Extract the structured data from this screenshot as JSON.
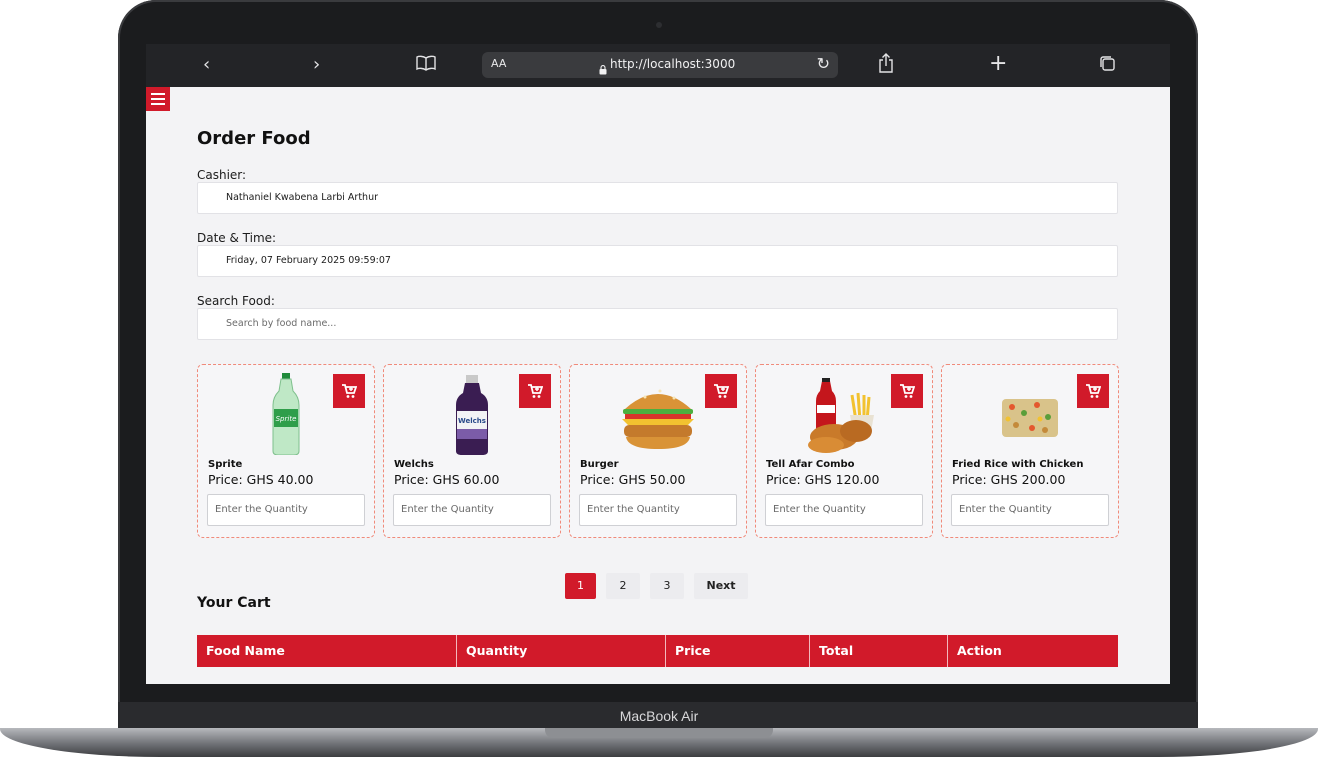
{
  "browser": {
    "aa_label": "AA",
    "url": "http://localhost:3000"
  },
  "device": {
    "label": "MacBook Air"
  },
  "page": {
    "title": "Order Food",
    "cashier_label": "Cashier:",
    "cashier_value": "Nathaniel Kwabena Larbi Arthur",
    "datetime_label": "Date & Time:",
    "datetime_value": "Friday, 07 February 2025 09:59:07",
    "search_label": "Search Food:",
    "search_placeholder": "Search by food name..."
  },
  "foods": [
    {
      "name": "Sprite",
      "price": "Price: GHS 40.00",
      "qty_placeholder": "Enter the Quantity",
      "image": "sprite-bottle"
    },
    {
      "name": "Welchs",
      "price": "Price: GHS 60.00",
      "qty_placeholder": "Enter the Quantity",
      "image": "welchs-bottle"
    },
    {
      "name": "Burger",
      "price": "Price: GHS 50.00",
      "qty_placeholder": "Enter the Quantity",
      "image": "burger"
    },
    {
      "name": "Tell Afar Combo",
      "price": "Price: GHS 120.00",
      "qty_placeholder": "Enter the Quantity",
      "image": "chicken-combo"
    },
    {
      "name": "Fried Rice with Chicken",
      "price": "Price: GHS 200.00",
      "qty_placeholder": "Enter the Quantity",
      "image": "fried-rice"
    }
  ],
  "pagination": {
    "pages": [
      "1",
      "2",
      "3"
    ],
    "active": "1",
    "next_label": "Next"
  },
  "cart": {
    "title": "Your Cart",
    "columns": [
      "Food Name",
      "Quantity",
      "Price",
      "Total",
      "Action"
    ]
  },
  "colors": {
    "accent": "#d11a2a",
    "card_border": "#f08a7a"
  },
  "icons": {
    "menu": "hamburger-icon",
    "cart": "add-to-cart-icon"
  }
}
